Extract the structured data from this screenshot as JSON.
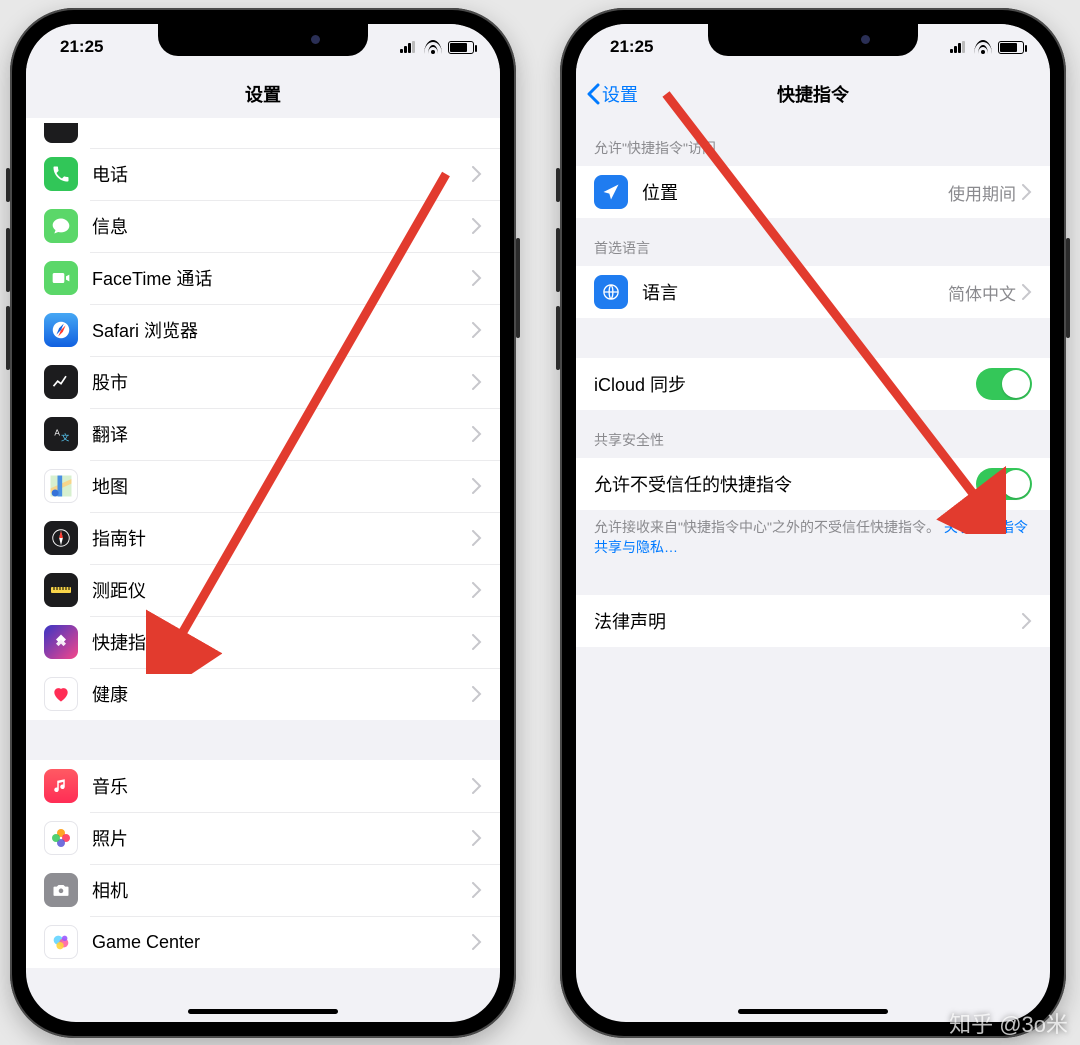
{
  "status": {
    "time": "21:25"
  },
  "watermark": "知乎 @3o米",
  "left": {
    "title": "设置",
    "rows": [
      {
        "id": "phone",
        "label": "电话"
      },
      {
        "id": "messages",
        "label": "信息"
      },
      {
        "id": "facetime",
        "label": "FaceTime 通话"
      },
      {
        "id": "safari",
        "label": "Safari 浏览器"
      },
      {
        "id": "stocks",
        "label": "股市"
      },
      {
        "id": "translate",
        "label": "翻译"
      },
      {
        "id": "maps",
        "label": "地图"
      },
      {
        "id": "compass",
        "label": "指南针"
      },
      {
        "id": "measure",
        "label": "测距仪"
      },
      {
        "id": "shortcuts",
        "label": "快捷指令"
      },
      {
        "id": "health",
        "label": "健康"
      },
      {
        "id": "music",
        "label": "音乐"
      },
      {
        "id": "photos",
        "label": "照片"
      },
      {
        "id": "camera",
        "label": "相机"
      },
      {
        "id": "gamecenter",
        "label": "Game Center"
      }
    ]
  },
  "right": {
    "back": "设置",
    "title": "快捷指令",
    "sections": {
      "access_header": "允许\"快捷指令\"访问",
      "location": {
        "label": "位置",
        "detail": "使用期间"
      },
      "lang_header": "首选语言",
      "language": {
        "label": "语言",
        "detail": "简体中文"
      },
      "icloud": {
        "label": "iCloud 同步"
      },
      "security_header": "共享安全性",
      "untrusted": {
        "label": "允许不受信任的快捷指令"
      },
      "footer_text": "允许接收来自\"快捷指令中心\"之外的不受信任快捷指令。",
      "footer_link": "关于快捷指令共享与隐私…",
      "legal": {
        "label": "法律声明"
      }
    }
  }
}
